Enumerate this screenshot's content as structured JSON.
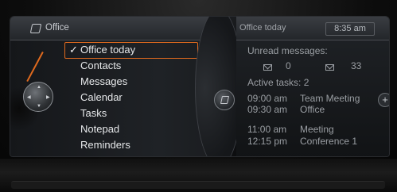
{
  "menu": {
    "header_title": "Office",
    "items": [
      {
        "label": "Office today",
        "selected": true
      },
      {
        "label": "Contacts",
        "selected": false
      },
      {
        "label": "Messages",
        "selected": false
      },
      {
        "label": "Calendar",
        "selected": false
      },
      {
        "label": "Tasks",
        "selected": false
      },
      {
        "label": "Notepad",
        "selected": false
      },
      {
        "label": "Reminders",
        "selected": false
      }
    ],
    "check_mark": "✓"
  },
  "detail": {
    "title": "Office today",
    "time": "8:35 am",
    "unread_label": "Unread messages:",
    "email_count": "0",
    "sms_count": "33",
    "tasks_label": "Active tasks: 2",
    "tasks": [
      {
        "time": "09:00 am",
        "label": "Team Meeting"
      },
      {
        "time": "09:30 am",
        "label": "Office"
      },
      {
        "time": "11:00 am",
        "label": "Meeting"
      },
      {
        "time": "12:15 pm",
        "label": "Conference 1"
      }
    ],
    "more_symbol": "+"
  },
  "colors": {
    "accent": "#e06a1e",
    "text_primary": "#e6e8ea",
    "text_secondary": "#9a9ea3"
  },
  "icons": [
    "office-icon",
    "controller-knob-icon",
    "envelope-icon",
    "sms-icon",
    "add-icon"
  ]
}
